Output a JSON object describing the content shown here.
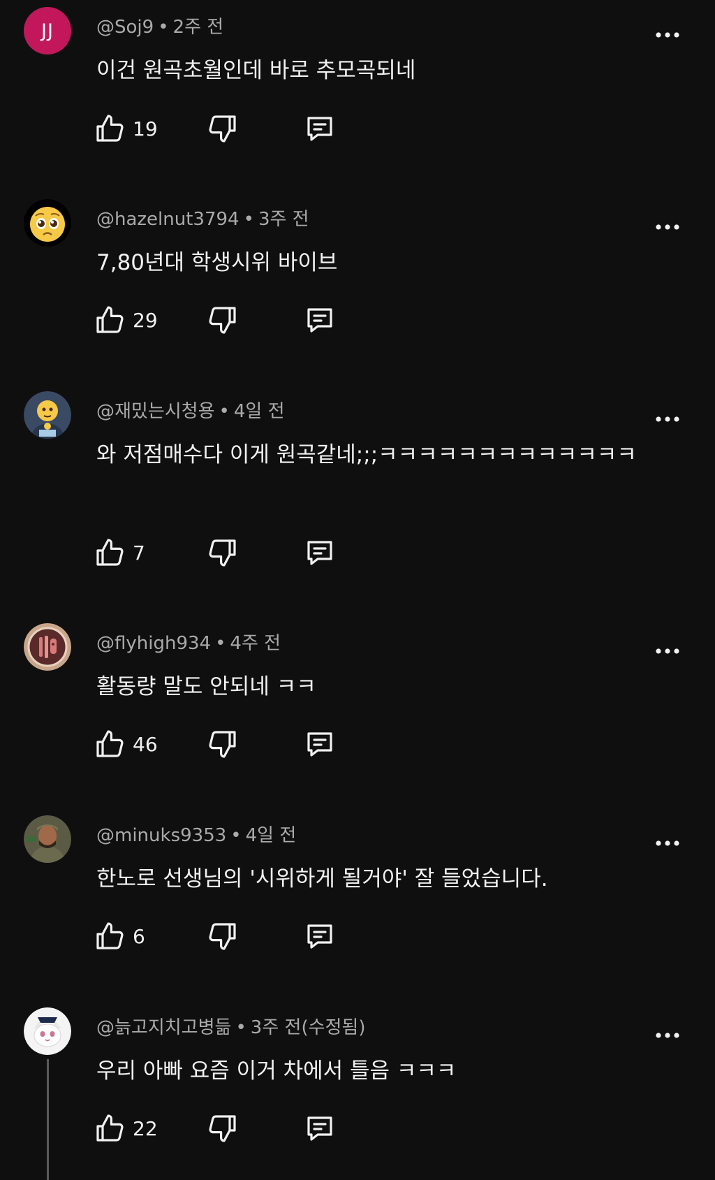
{
  "comments": [
    {
      "avatar_text": "JJ",
      "author": "@Soj9",
      "time": "2주 전",
      "text": "이건 원곡초월인데 바로 추모곡되네",
      "likes": "19"
    },
    {
      "avatar_icon": "pleading-face-emoji-avatar",
      "author": "@hazelnut3794",
      "time": "3주 전",
      "text": "7,80년대 학생시위 바이브",
      "likes": "29"
    },
    {
      "avatar_icon": "face-holding-back-tears-avatar",
      "author": "@재밌는시청용",
      "time": "4일 전",
      "text": "와 저점매수다 이게 원곡같네;;;ㅋㅋㅋㅋㅋㅋㅋㅋㅋㅋㅋㅋㅋ",
      "likes": "7"
    },
    {
      "avatar_icon": "food-sign-avatar",
      "author": "@flyhigh934",
      "time": "4주 전",
      "text": "활동량 말도 안되네 ㅋㅋ",
      "likes": "46"
    },
    {
      "avatar_icon": "soldier-portrait-avatar",
      "author": "@minuks9353",
      "time": "4일 전",
      "text": "한노로 선생님의 '시위하게 될거야' 잘 들었습니다.",
      "likes": "6"
    },
    {
      "avatar_icon": "white-cat-avatar",
      "author": "@늙고지치고병듦",
      "time": "3주 전(수정됨)",
      "text": "우리 아빠 요즘 이거 차에서 틀음 ㅋㅋㅋ",
      "likes": "22"
    }
  ],
  "separator": "•",
  "icons": {
    "like": "thumbs-up-icon",
    "dislike": "thumbs-down-icon",
    "reply": "reply-comment-icon",
    "more": "more-options-icon"
  },
  "colors": {
    "background": "#0f0f0f",
    "text_primary": "#f1f1f1",
    "text_secondary": "#aaaaaa",
    "avatar_jj": "#c2185b"
  }
}
